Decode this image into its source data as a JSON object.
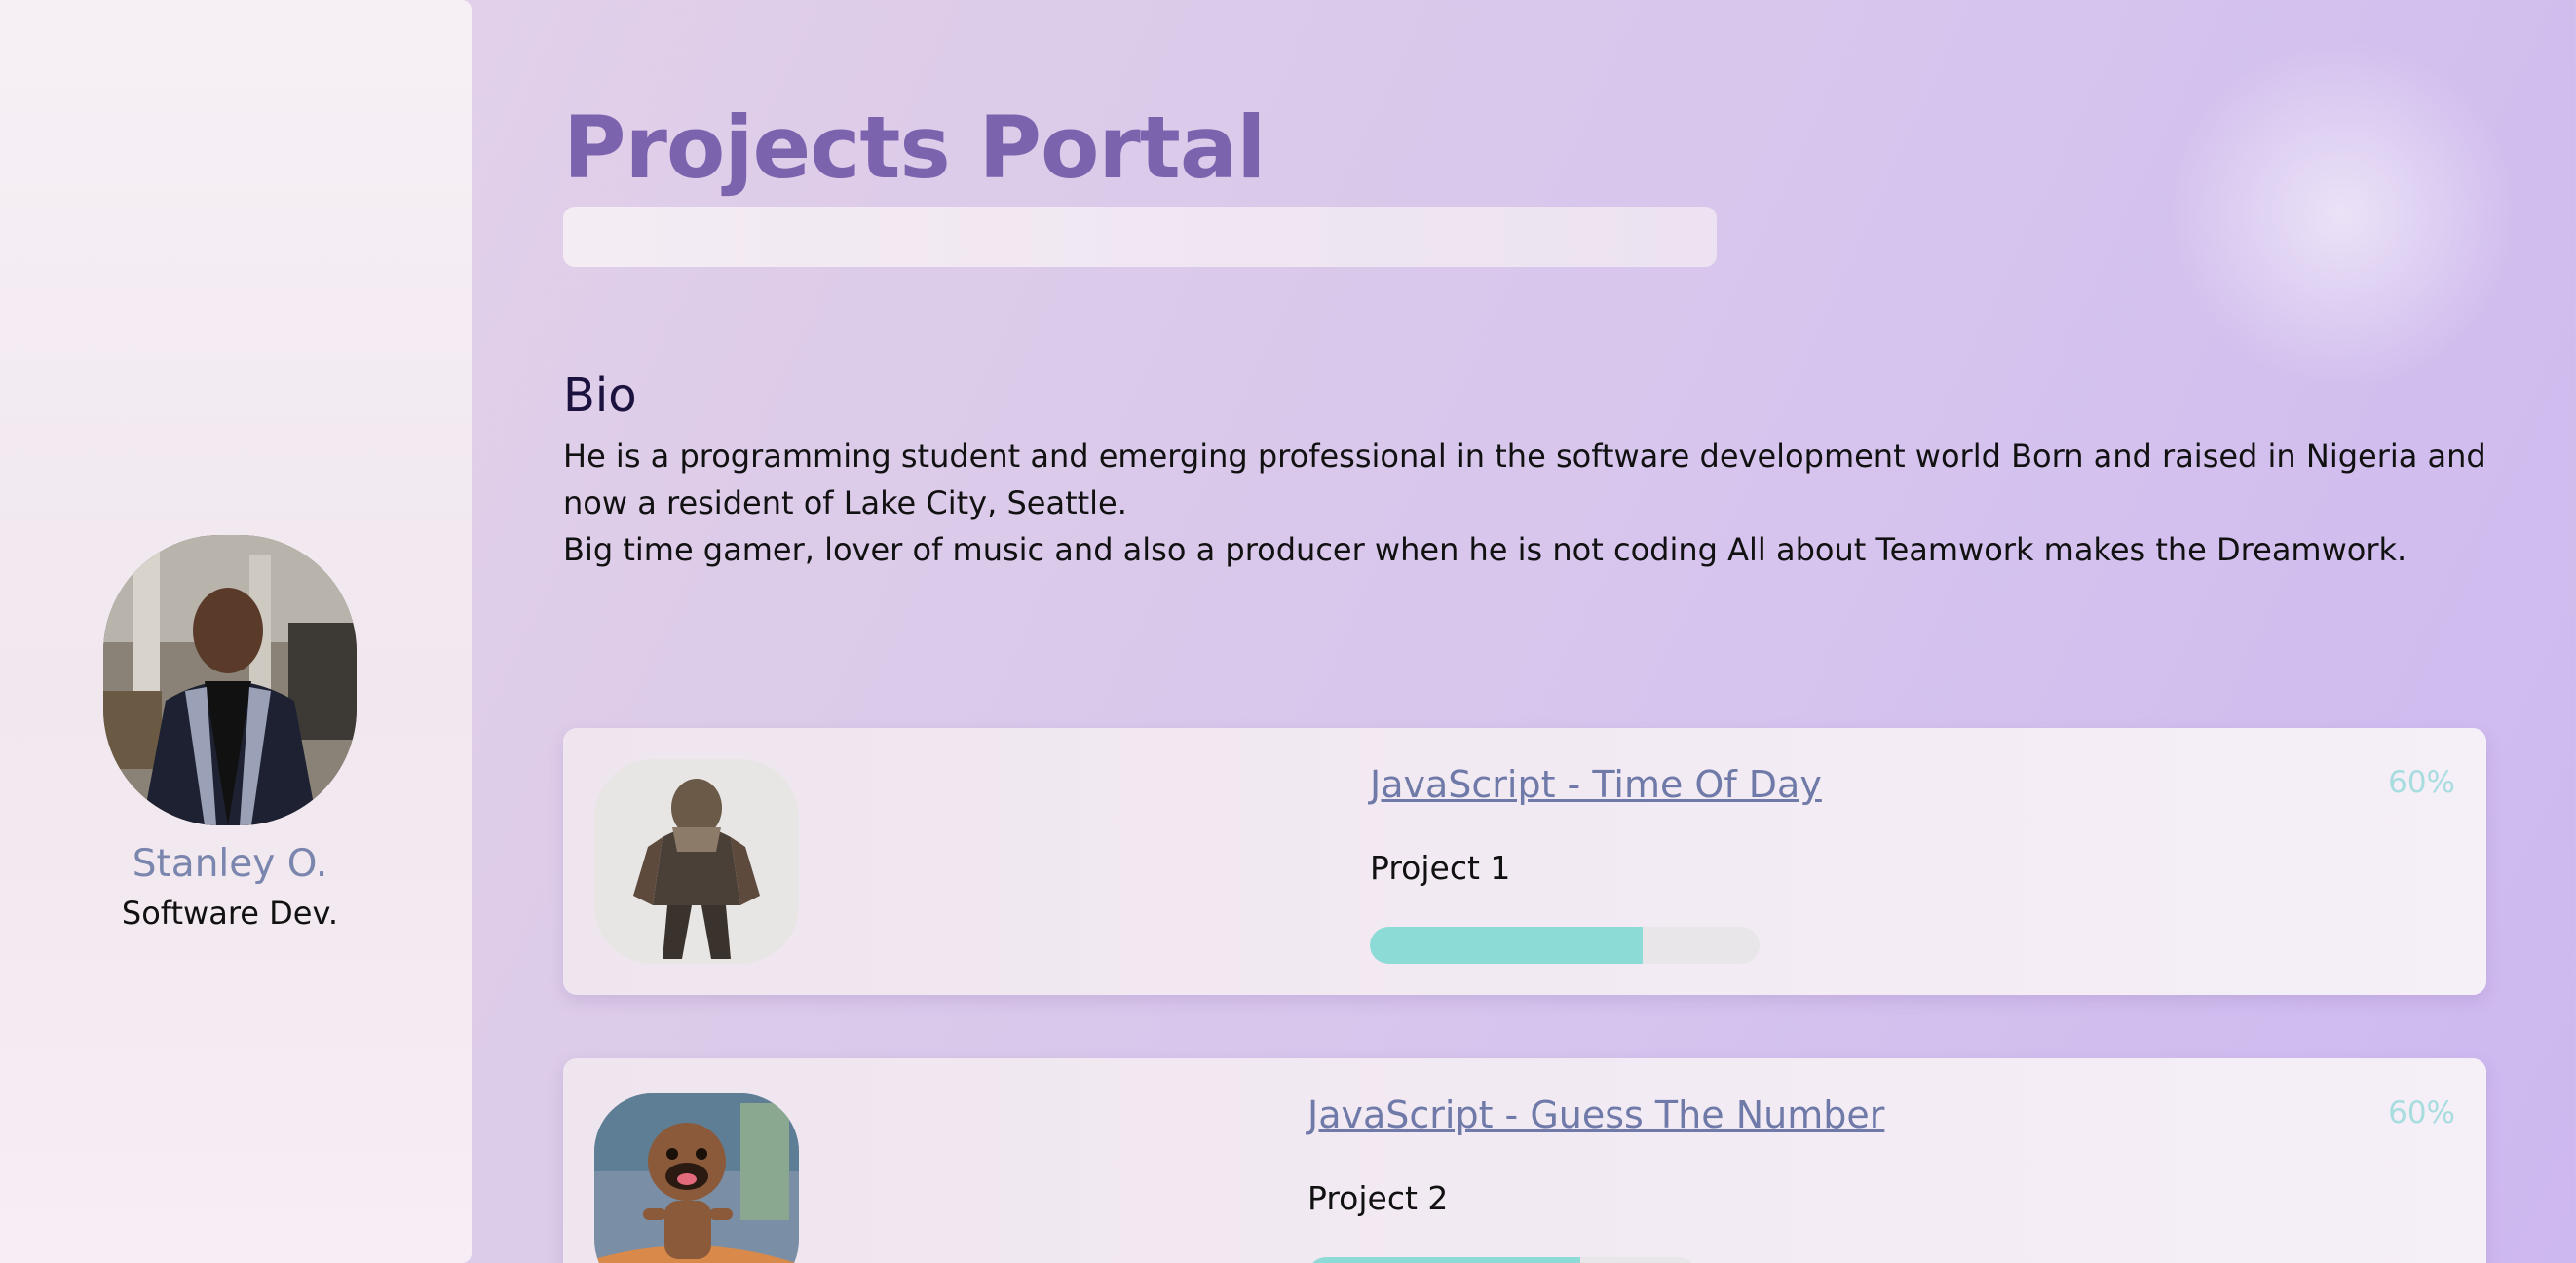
{
  "colors": {
    "accent_title": "#7c63ad",
    "link": "#6f7aa8",
    "progress_fill": "#8cdbd7",
    "percent_text": "#a8dde0"
  },
  "sidebar": {
    "name": "Stanley O.",
    "role": "Software Dev."
  },
  "header": {
    "title": "Projects Portal",
    "search": {
      "value": "",
      "placeholder": ""
    }
  },
  "bio": {
    "heading": "Bio",
    "paragraph_1": "He is a programming student and emerging professional in the software development world Born and raised in Nigeria and now a resident of Lake City, Seattle.",
    "paragraph_2": "Big time gamer, lover of music and also a producer when he is not coding All about Teamwork makes the Dreamwork."
  },
  "projects": [
    {
      "title": "JavaScript - Time Of Day",
      "subtitle": "Project 1",
      "percent_label": "60%",
      "progress": 0.7
    },
    {
      "title": "JavaScript - Guess The Number",
      "subtitle": "Project 2",
      "percent_label": "60%",
      "progress": 0.7
    }
  ]
}
